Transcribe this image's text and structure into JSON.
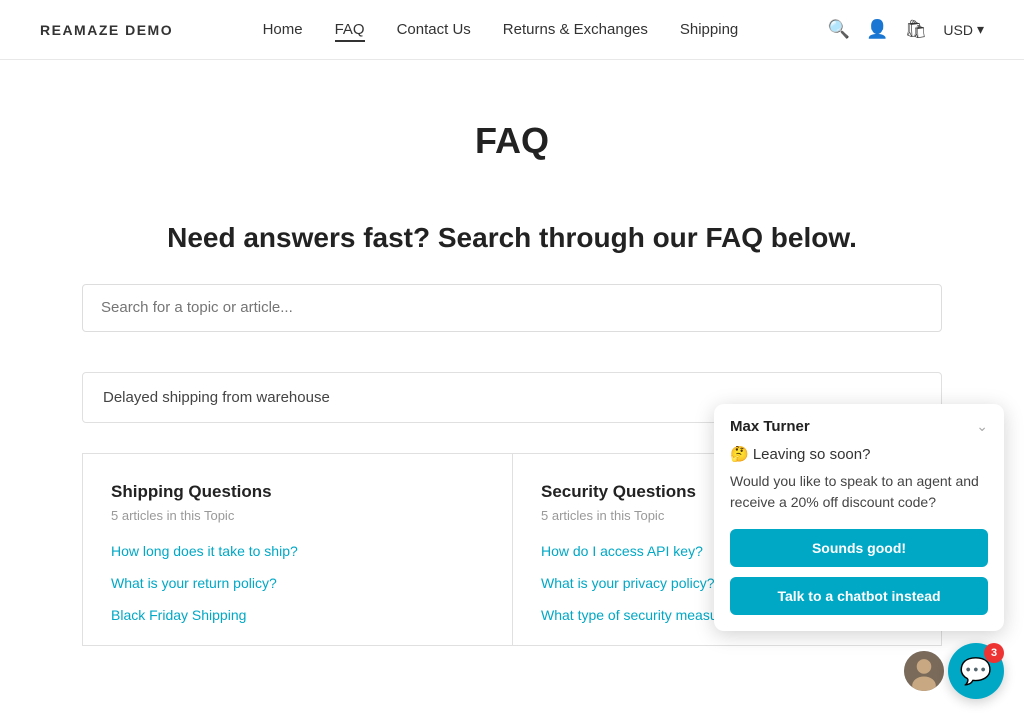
{
  "brand": "REAMAZE DEMO",
  "nav": {
    "links": [
      {
        "label": "Home",
        "active": false
      },
      {
        "label": "FAQ",
        "active": true
      },
      {
        "label": "Contact Us",
        "active": false
      },
      {
        "label": "Returns & Exchanges",
        "active": false
      },
      {
        "label": "Shipping",
        "active": false
      }
    ],
    "currency": "USD"
  },
  "page": {
    "title": "FAQ",
    "subtitle": "Need answers fast? Search through our FAQ below.",
    "search_placeholder": "Search for a topic or article..."
  },
  "delayed_banner": "Delayed shipping from warehouse",
  "topics": [
    {
      "title": "Shipping Questions",
      "count": "5 articles in this Topic",
      "links": [
        "How long does it take to ship?",
        "What is your return policy?",
        "Black Friday Shipping"
      ]
    },
    {
      "title": "Security Questions",
      "count": "5 articles in this Topic",
      "links": [
        "How do I access API key?",
        "What is your privacy policy?",
        "What type of security measures do you have?"
      ]
    }
  ],
  "chat": {
    "agent_name": "Max Turner",
    "leaving_text": "🤔 Leaving so soon?",
    "message": "Would you like to speak to an agent and receive a 20% off discount code?",
    "btn_primary": "Sounds good!",
    "btn_secondary": "Talk to a chatbot instead",
    "badge_count": "3"
  }
}
